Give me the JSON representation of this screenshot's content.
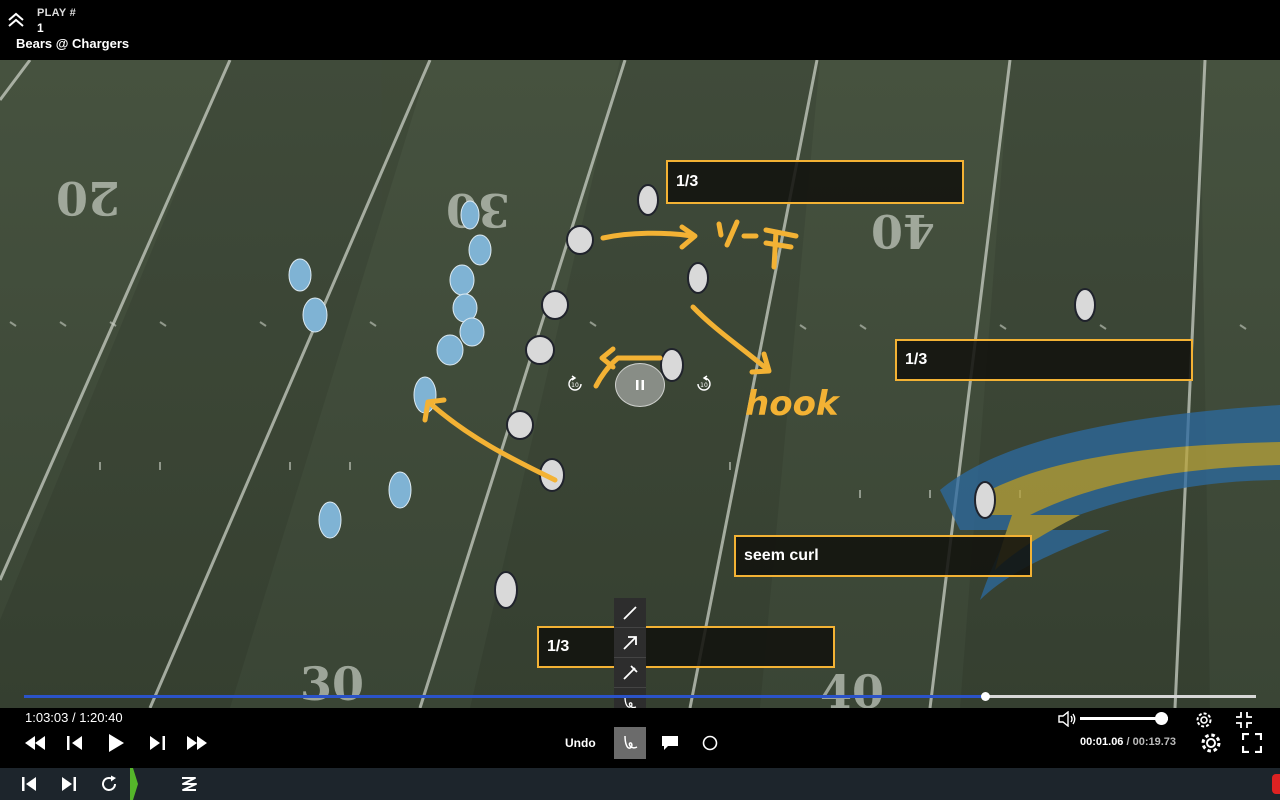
{
  "header": {
    "play_label": "PLAY #",
    "play_number": "1",
    "game_title": "Bears @ Chargers",
    "collapse_icon": "chevron-double-up-icon"
  },
  "video": {
    "yard_numbers": [
      "20",
      "30",
      "40",
      "30",
      "40"
    ],
    "drawings": {
      "text_hook": "hook",
      "text_top": "1/4 T"
    },
    "notes": [
      {
        "text": "1/3"
      },
      {
        "text": "1/3"
      },
      {
        "text": "seem curl"
      },
      {
        "text": "1/3"
      }
    ],
    "overlay": {
      "rewind_icon": "rewind-10-icon",
      "rewind_label": "10",
      "pause_icon": "pause-icon",
      "forward_icon": "forward-10-icon",
      "forward_label": "10"
    },
    "draw_tools": [
      "line-tool-icon",
      "arrow-tool-icon",
      "block-tool-icon",
      "freehand-tool-icon"
    ]
  },
  "progress": {
    "played_fraction": 0.78
  },
  "controls": {
    "time_main": "1:03:03 / 1:20:40",
    "undo_label": "Undo",
    "clip_current": "00:01.06",
    "clip_separator": " / ",
    "clip_total": "00:19.73",
    "volume_level": 0.92,
    "icons": [
      "fast-rewind-icon",
      "step-back-icon",
      "play-icon",
      "step-forward-icon",
      "fast-forward-icon",
      "pen-icon",
      "comment-icon",
      "circle-tool-icon",
      "volume-icon",
      "settings-icon",
      "collapse-icon",
      "settings-icon",
      "fullscreen-icon"
    ]
  },
  "bottombar": {
    "icons": [
      "skip-to-start-icon",
      "skip-to-end-icon",
      "loop-icon",
      "zoom-scribble-icon"
    ]
  },
  "colors": {
    "annotation": "#f3b234",
    "progress_played": "#2b53c9",
    "field": "#3e4a37"
  }
}
